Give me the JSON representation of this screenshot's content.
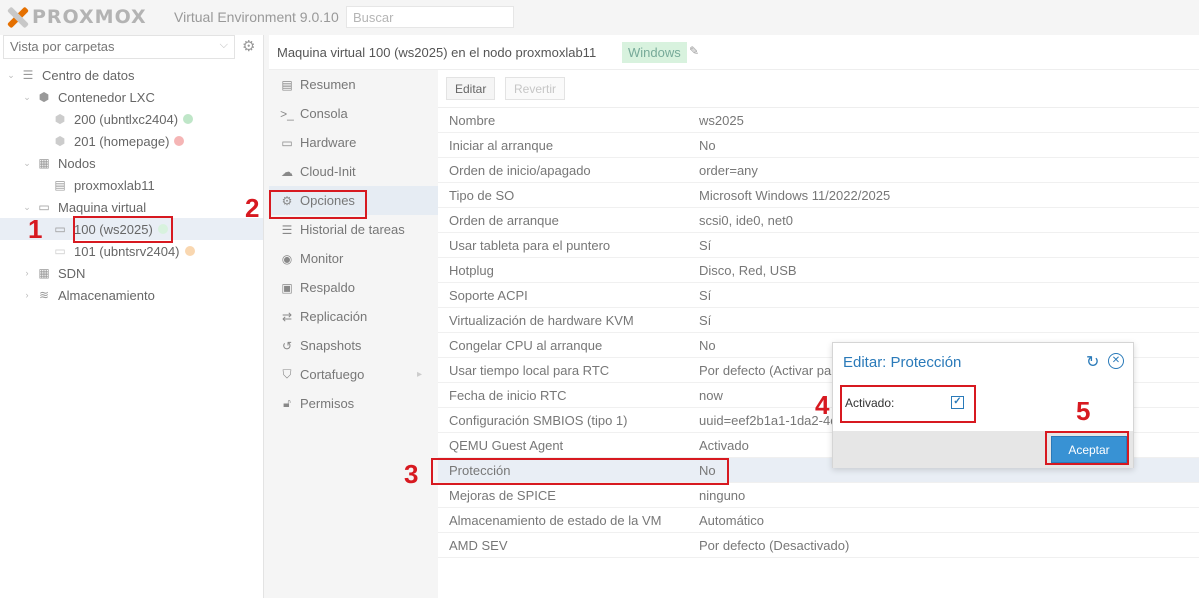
{
  "topbar": {
    "logo_text": "PROXMOX",
    "product": "Virtual Environment 9.0.10",
    "search_placeholder": "Buscar"
  },
  "left": {
    "view_selector": "Vista por carpetas",
    "tree": [
      {
        "label": "Centro de datos",
        "icon": "datacenter-icon"
      },
      {
        "label": "Contenedor LXC",
        "icon": "container-icon"
      },
      {
        "label": "200 (ubntlxc2404)",
        "icon": "lxc-icon",
        "status_color": "#8fd19e"
      },
      {
        "label": "201 (homepage)",
        "icon": "lxc-icon",
        "status_color": "#f29a9a"
      },
      {
        "label": "Nodos",
        "icon": "building-icon"
      },
      {
        "label": "proxmoxlab11",
        "icon": "node-icon"
      },
      {
        "label": "Maquina virtual",
        "icon": "monitor-icon"
      },
      {
        "label": "100 (ws2025)",
        "icon": "vm-icon",
        "status_color": "#d8f2de"
      },
      {
        "label": "101 (ubntsrv2404)",
        "icon": "vm-icon",
        "status_color": "#f7c48a"
      },
      {
        "label": "SDN",
        "icon": "grid-icon"
      },
      {
        "label": "Almacenamiento",
        "icon": "database-icon"
      }
    ]
  },
  "header": {
    "title": "Maquina virtual 100 (ws2025) en el nodo proxmoxlab11",
    "tag": "Windows"
  },
  "nav": [
    {
      "label": "Resumen",
      "icon": "book-icon"
    },
    {
      "label": "Consola",
      "icon": "terminal-icon"
    },
    {
      "label": "Hardware",
      "icon": "desktop-icon"
    },
    {
      "label": "Cloud-Init",
      "icon": "cloud-icon"
    },
    {
      "label": "Opciones",
      "icon": "gear-icon"
    },
    {
      "label": "Historial de tareas",
      "icon": "list-icon"
    },
    {
      "label": "Monitor",
      "icon": "eye-icon"
    },
    {
      "label": "Respaldo",
      "icon": "floppy-icon"
    },
    {
      "label": "Replicación",
      "icon": "retweet-icon"
    },
    {
      "label": "Snapshots",
      "icon": "history-icon"
    },
    {
      "label": "Cortafuego",
      "icon": "shield-icon"
    },
    {
      "label": "Permisos",
      "icon": "unlock-icon"
    }
  ],
  "toolbar": {
    "edit_label": "Editar",
    "revert_label": "Revertir"
  },
  "options": [
    {
      "key": "Nombre",
      "value": "ws2025"
    },
    {
      "key": "Iniciar al arranque",
      "value": "No"
    },
    {
      "key": "Orden de inicio/apagado",
      "value": "order=any"
    },
    {
      "key": "Tipo de SO",
      "value": "Microsoft Windows 11/2022/2025"
    },
    {
      "key": "Orden de arranque",
      "value": "scsi0, ide0, net0"
    },
    {
      "key": "Usar tableta para el puntero",
      "value": "Sí"
    },
    {
      "key": "Hotplug",
      "value": "Disco, Red, USB"
    },
    {
      "key": "Soporte ACPI",
      "value": "Sí"
    },
    {
      "key": "Virtualización de hardware KVM",
      "value": "Sí"
    },
    {
      "key": "Congelar CPU al arranque",
      "value": "No"
    },
    {
      "key": "Usar tiempo local para RTC",
      "value": "Por defecto (Activar par"
    },
    {
      "key": "Fecha de inicio RTC",
      "value": "now"
    },
    {
      "key": "Configuración SMBIOS (tipo 1)",
      "value": "uuid=eef2b1a1-1da2-4c"
    },
    {
      "key": "QEMU Guest Agent",
      "value": "Activado"
    },
    {
      "key": "Protección",
      "value": "No"
    },
    {
      "key": "Mejoras de SPICE",
      "value": "ninguno"
    },
    {
      "key": "Almacenamiento de estado de la VM",
      "value": "Automático"
    },
    {
      "key": "AMD SEV",
      "value": "Por defecto (Desactivado)"
    }
  ],
  "dialog": {
    "title": "Editar: Protección",
    "field_label": "Activado:",
    "checked": true,
    "ok_label": "Aceptar"
  },
  "annotations": [
    "1",
    "2",
    "3",
    "4",
    "5"
  ],
  "colors": {
    "annotation_red": "#d71920",
    "accent_blue": "#2a7ab9",
    "button_blue": "#3892d4",
    "logo_orange": "#e57000"
  }
}
